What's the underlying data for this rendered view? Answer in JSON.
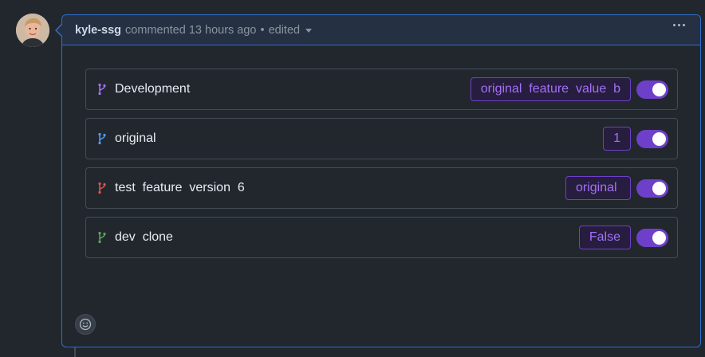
{
  "comment": {
    "author": "kyle-ssg",
    "action": "commented",
    "time": "13 hours ago",
    "separator": "•",
    "edited_label": "edited"
  },
  "rows": [
    {
      "label": "Development",
      "tag": "original  feature  value  b",
      "icon_color": "#a371f7",
      "enabled": true
    },
    {
      "label": "original",
      "tag": "1",
      "icon_color": "#539bf5",
      "enabled": true
    },
    {
      "label": "test  feature  version  6",
      "tag": "original ",
      "icon_color": "#e5534b",
      "enabled": true
    },
    {
      "label": "dev  clone",
      "tag": "False",
      "icon_color": "#57ab5a",
      "enabled": true
    }
  ],
  "icons": {
    "branch": "git-branch-icon",
    "emoji": "smiley-icon",
    "menu": "kebab-menu-icon",
    "caret": "caret-down-icon"
  },
  "colors": {
    "accent": "#6e40c9",
    "tag_text": "#a371f7",
    "header_bg": "#253143",
    "border_focus": "#316dca"
  }
}
